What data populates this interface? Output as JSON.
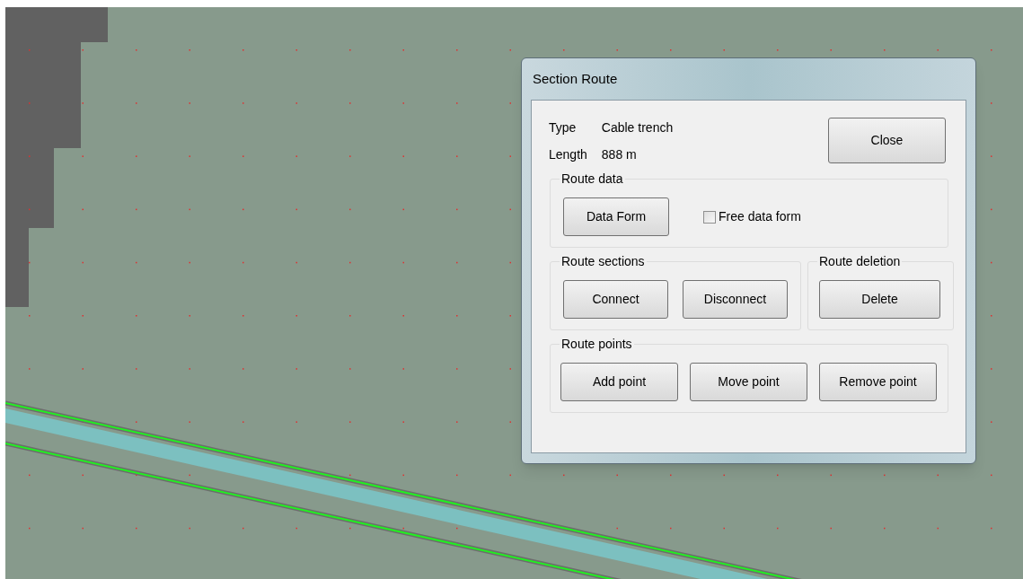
{
  "window": {
    "title": "Section Route"
  },
  "info": [
    {
      "label": "Type",
      "value": "Cable trench"
    },
    {
      "label": "Length",
      "value": "888 m"
    }
  ],
  "close_button": "Close",
  "group_rows": [
    [
      {
        "title": "Route data",
        "items": [
          {
            "kind": "button",
            "label": "Data Form"
          },
          {
            "kind": "checkbox",
            "label": "Free data form",
            "checked": false
          }
        ]
      }
    ],
    [
      {
        "title": "Route sections",
        "items": [
          {
            "kind": "button",
            "label": "Connect"
          },
          {
            "kind": "button",
            "label": "Disconnect"
          }
        ]
      },
      {
        "title": "Route deletion",
        "items": [
          {
            "kind": "button",
            "label": "Delete"
          }
        ]
      }
    ],
    [
      {
        "title": "Route points",
        "items": [
          {
            "kind": "button",
            "label": "Add point"
          },
          {
            "kind": "button",
            "label": "Move point"
          },
          {
            "kind": "button",
            "label": "Remove point"
          }
        ]
      }
    ]
  ]
}
